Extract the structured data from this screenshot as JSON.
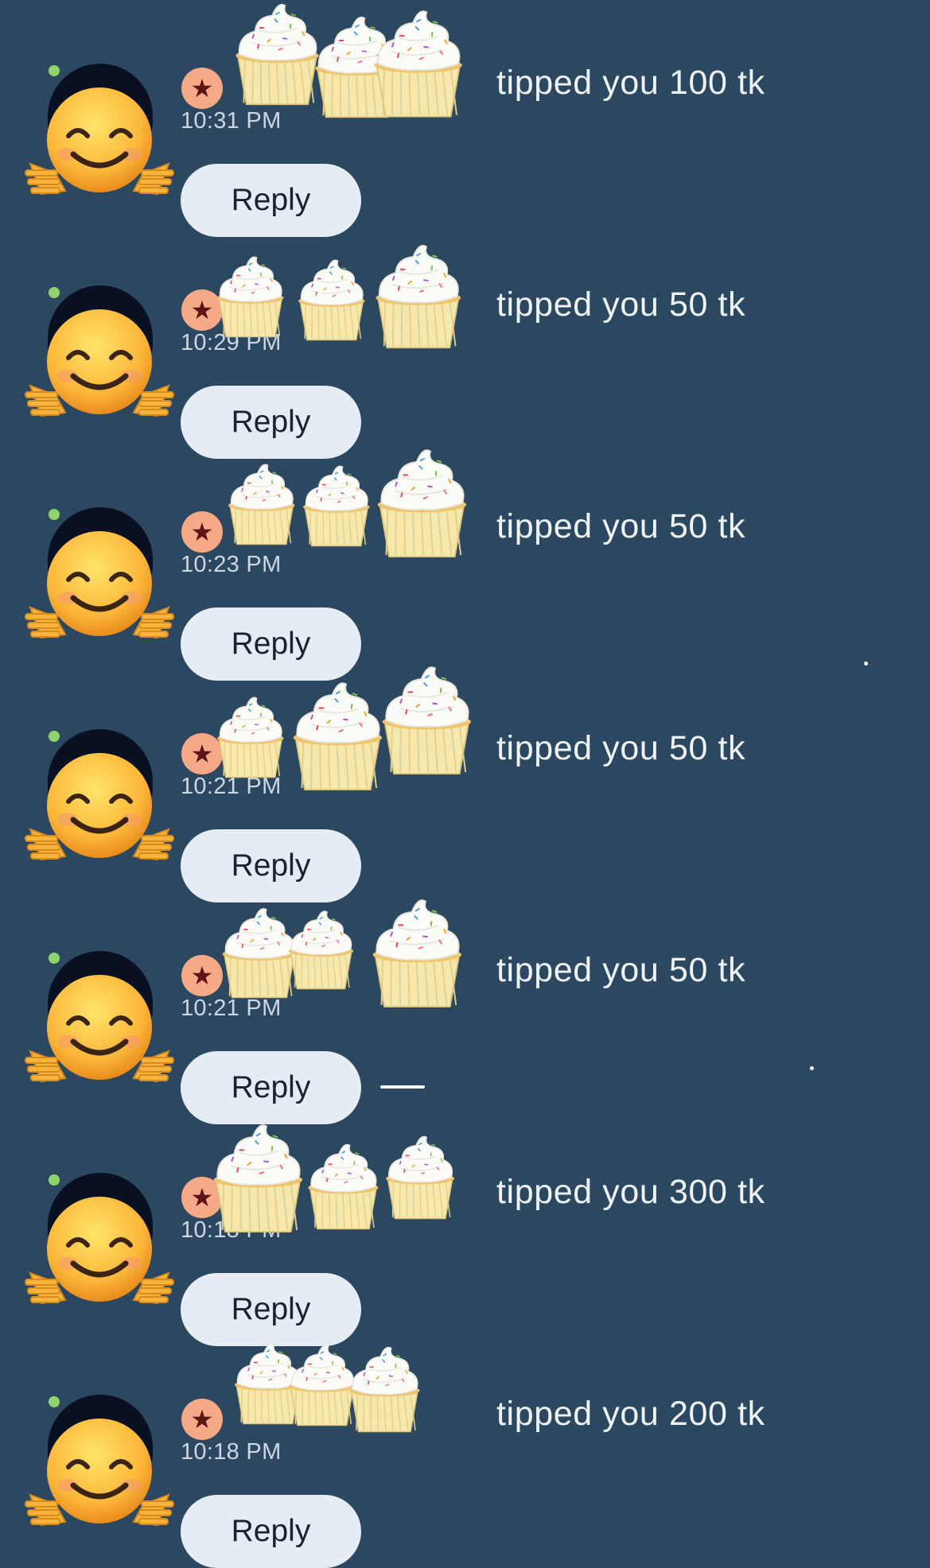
{
  "notifications": [
    {
      "time": "10:31 PM",
      "message": "tipped you 100 tk",
      "reply_label": "Reply",
      "icon": "star-icon",
      "avatar": "hugging-face-emoji"
    },
    {
      "time": "10:29 PM",
      "message": "tipped you 50 tk",
      "reply_label": "Reply",
      "icon": "star-icon",
      "avatar": "hugging-face-emoji"
    },
    {
      "time": "10:23 PM",
      "message": "tipped you 50 tk",
      "reply_label": "Reply",
      "icon": "star-icon",
      "avatar": "hugging-face-emoji"
    },
    {
      "time": "10:21 PM",
      "message": "tipped you 50 tk",
      "reply_label": "Reply",
      "icon": "star-icon",
      "avatar": "hugging-face-emoji"
    },
    {
      "time": "10:21 PM",
      "message": "tipped you 50 tk",
      "reply_label": "Reply",
      "icon": "star-icon",
      "avatar": "hugging-face-emoji"
    },
    {
      "time": "10:18 PM",
      "message": "tipped you 300 tk",
      "reply_label": "Reply",
      "icon": "star-icon",
      "avatar": "hugging-face-emoji"
    },
    {
      "time": "10:18 PM",
      "message": "tipped you 200 tk",
      "reply_label": "Reply",
      "icon": "star-icon",
      "avatar": "hugging-face-emoji"
    }
  ],
  "sticker": "cupcake-sticker",
  "colors": {
    "background": "#2c4760",
    "badge": "#f6a987",
    "reply_button": "#e6ecf4",
    "text": "#eef3f8"
  }
}
